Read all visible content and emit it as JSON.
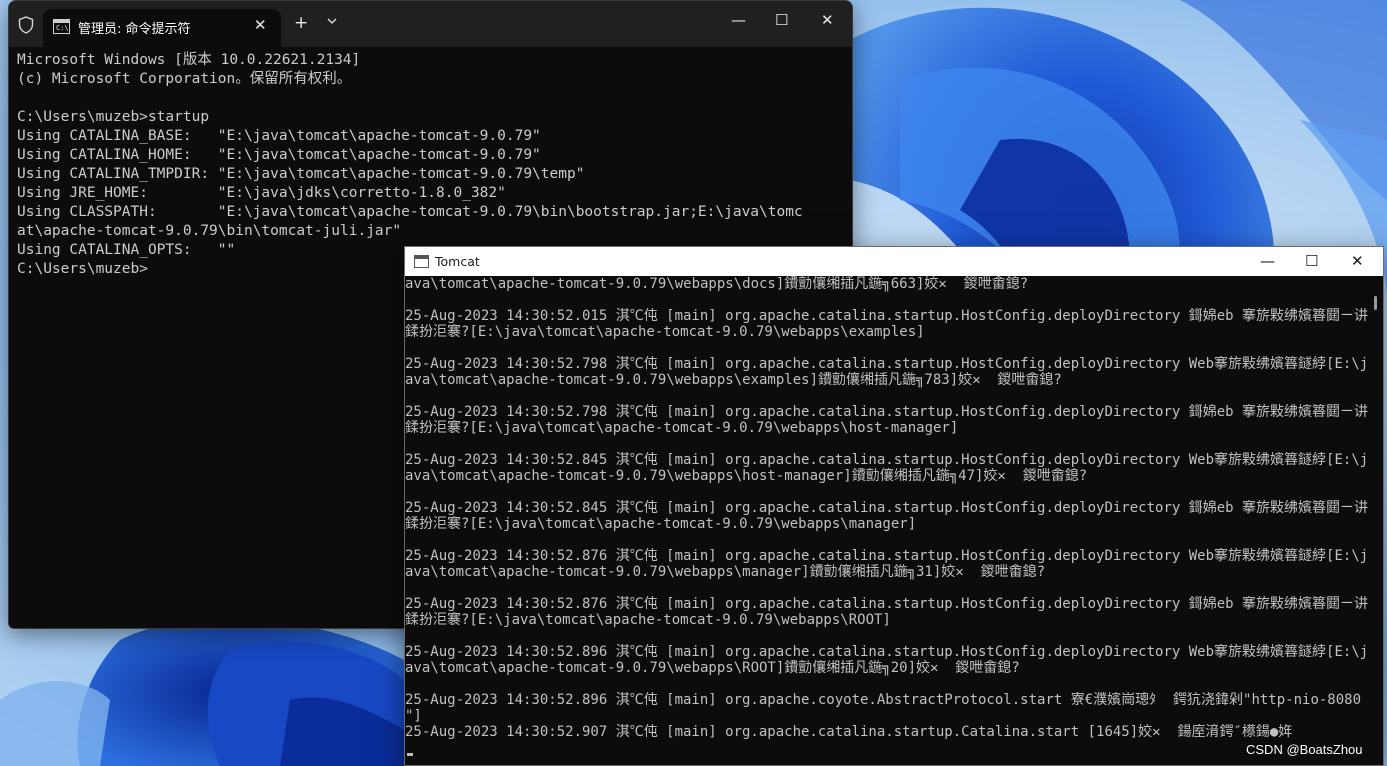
{
  "cmd": {
    "tab_title": "管理员: 命令提示符",
    "tab_icon_text": "C:\\",
    "close_glyph": "✕",
    "new_tab_glyph": "+",
    "minimize_glyph": "—",
    "maximize_glyph": "☐",
    "window_close_glyph": "✕",
    "lines": [
      "Microsoft Windows [版本 10.0.22621.2134]",
      "(c) Microsoft Corporation。保留所有权利。",
      "",
      "C:\\Users\\muzeb>startup",
      "Using CATALINA_BASE:   \"E:\\java\\tomcat\\apache-tomcat-9.0.79\"",
      "Using CATALINA_HOME:   \"E:\\java\\tomcat\\apache-tomcat-9.0.79\"",
      "Using CATALINA_TMPDIR: \"E:\\java\\tomcat\\apache-tomcat-9.0.79\\temp\"",
      "Using JRE_HOME:        \"E:\\java\\jdks\\corretto-1.8.0_382\"",
      "Using CLASSPATH:       \"E:\\java\\tomcat\\apache-tomcat-9.0.79\\bin\\bootstrap.jar;E:\\java\\tomc",
      "at\\apache-tomcat-9.0.79\\bin\\tomcat-juli.jar\"",
      "Using CATALINA_OPTS:   \"\"",
      "C:\\Users\\muzeb>"
    ]
  },
  "tomcat": {
    "title": "Tomcat",
    "minimize_glyph": "—",
    "maximize_glyph": "☐",
    "close_glyph": "✕",
    "lines": [
      "ava\\tomcat\\apache-tomcat-9.0.79\\webapps\\docs]鐨勯儴缃插凡鍦╗663]姣✕  鍐呭畬鎴?",
      "",
      "25-Aug-2023 14:30:52.015 淇℃伅 [main] org.apache.catalina.startup.HostConfig.deployDirectory 鎶婂eb 搴旂敤绋嬪簭閮ㄧ讲",
      "鍒扮洰褰?[E:\\java\\tomcat\\apache-tomcat-9.0.79\\webapps\\examples]",
      "",
      "25-Aug-2023 14:30:52.798 淇℃伅 [main] org.apache.catalina.startup.HostConfig.deployDirectory Web搴旂敤绋嬪簭鐩綍[E:\\j",
      "ava\\tomcat\\apache-tomcat-9.0.79\\webapps\\examples]鐨勯儴缃插凡鍦╗783]姣✕  鍐呭畬鎴?",
      "",
      "25-Aug-2023 14:30:52.798 淇℃伅 [main] org.apache.catalina.startup.HostConfig.deployDirectory 鎶婂eb 搴旂敤绋嬪簭閮ㄧ讲",
      "鍒扮洰褰?[E:\\java\\tomcat\\apache-tomcat-9.0.79\\webapps\\host-manager]",
      "",
      "25-Aug-2023 14:30:52.845 淇℃伅 [main] org.apache.catalina.startup.HostConfig.deployDirectory Web搴旂敤绋嬪簭鐩綍[E:\\j",
      "ava\\tomcat\\apache-tomcat-9.0.79\\webapps\\host-manager]鐨勯儴缃插凡鍦╗47]姣✕  鍐呭畬鎴?",
      "",
      "25-Aug-2023 14:30:52.845 淇℃伅 [main] org.apache.catalina.startup.HostConfig.deployDirectory 鎶婂eb 搴旂敤绋嬪簭閮ㄧ讲",
      "鍒扮洰褰?[E:\\java\\tomcat\\apache-tomcat-9.0.79\\webapps\\manager]",
      "",
      "25-Aug-2023 14:30:52.876 淇℃伅 [main] org.apache.catalina.startup.HostConfig.deployDirectory Web搴旂敤绋嬪簭鐩綍[E:\\j",
      "ava\\tomcat\\apache-tomcat-9.0.79\\webapps\\manager]鐨勯儴缃插凡鍦╗31]姣✕  鍐呭畬鎴?",
      "",
      "25-Aug-2023 14:30:52.876 淇℃伅 [main] org.apache.catalina.startup.HostConfig.deployDirectory 鎶婂eb 搴旂敤绋嬪簭閮ㄧ讲",
      "鍒扮洰褰?[E:\\java\\tomcat\\apache-tomcat-9.0.79\\webapps\\ROOT]",
      "",
      "25-Aug-2023 14:30:52.896 淇℃伅 [main] org.apache.catalina.startup.HostConfig.deployDirectory Web搴旂敤绋嬪簭鐩綍[E:\\j",
      "ava\\tomcat\\apache-tomcat-9.0.79\\webapps\\ROOT]鐨勯儴缃插凡鍦╗20]姣✕  鍐呭畬鎴?",
      "",
      "25-Aug-2023 14:30:52.896 淇℃伅 [main] org.apache.coyote.AbstractProtocol.start 寮€濮嬪崗璁ﾀ  鍔犺浇鍏剁\"http-nio-8080",
      "\"]",
      "25-Aug-2023 14:30:52.907 淇℃伅 [main] org.apache.catalina.startup.Catalina.start [1645]姣✕  鍚庢湇鍔″櫒鍚●姩"
    ]
  },
  "watermark": "CSDN @BoatsZhou"
}
